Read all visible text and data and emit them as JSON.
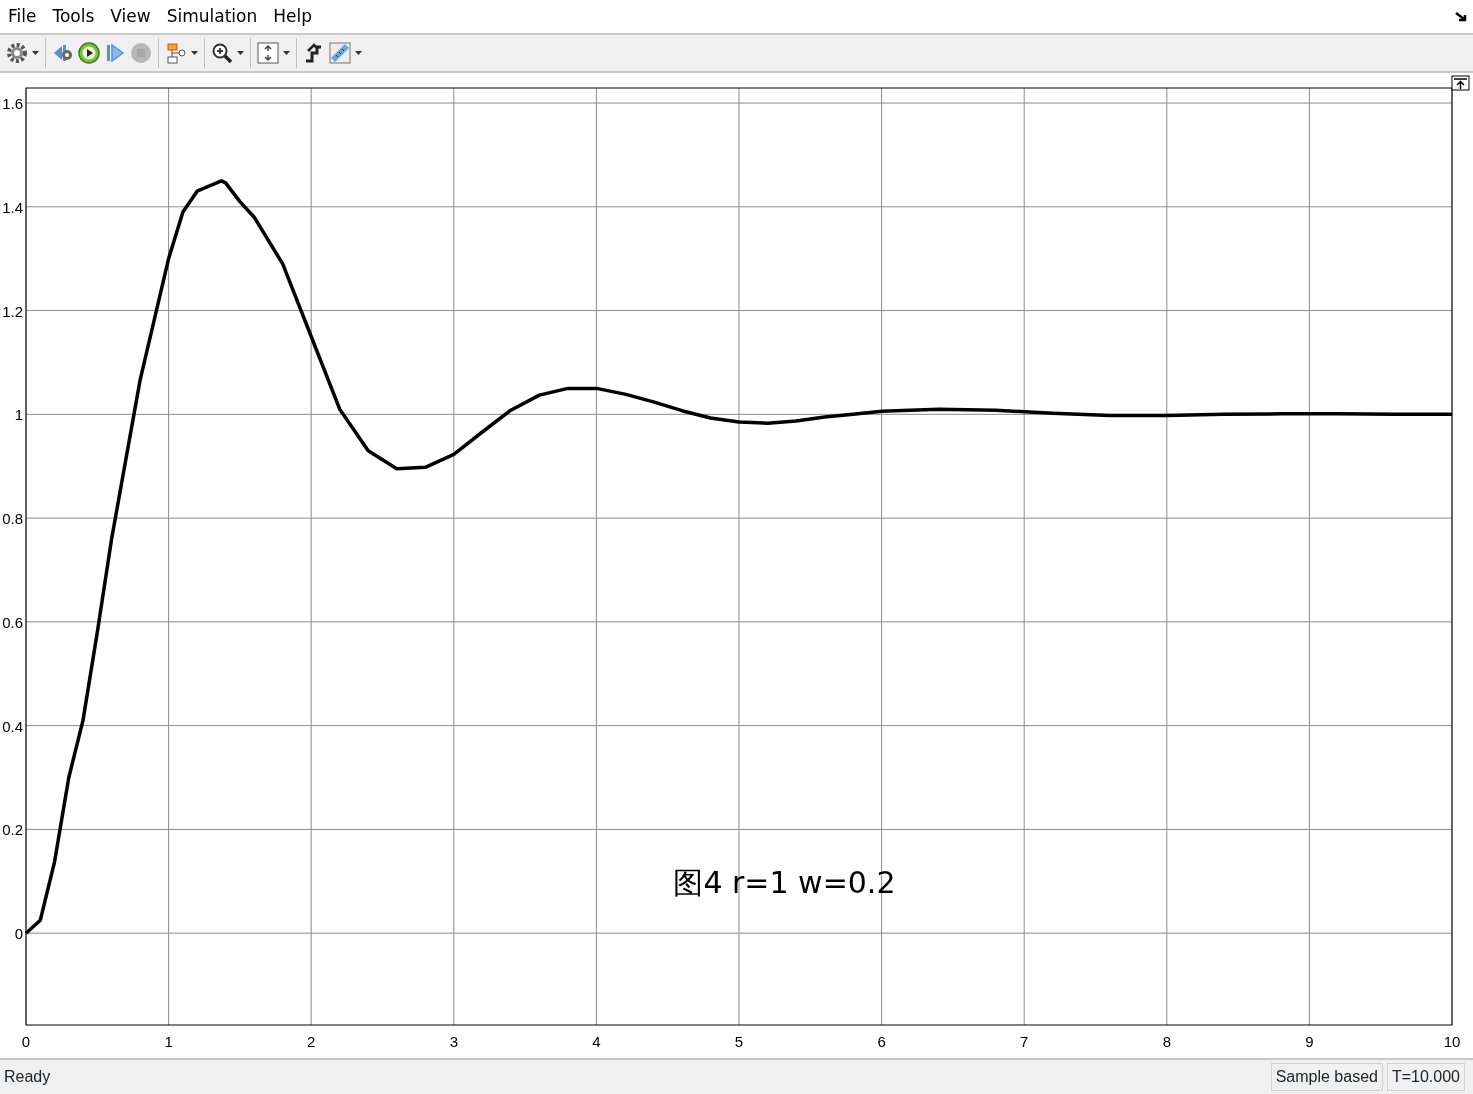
{
  "menu": [
    "File",
    "Tools",
    "View",
    "Simulation",
    "Help"
  ],
  "toolbar": [
    [
      {
        "kind": "settings",
        "dropdown": true,
        "disabled": false
      }
    ],
    [
      {
        "kind": "step-back",
        "dropdown": false,
        "disabled": false
      },
      {
        "kind": "run",
        "dropdown": false,
        "disabled": false
      },
      {
        "kind": "step-forward",
        "dropdown": false,
        "disabled": false
      },
      {
        "kind": "stop",
        "dropdown": false,
        "disabled": true
      }
    ],
    [
      {
        "kind": "signals",
        "dropdown": true,
        "disabled": false
      }
    ],
    [
      {
        "kind": "zoom",
        "dropdown": true,
        "disabled": false
      }
    ],
    [
      {
        "kind": "autoscale",
        "dropdown": true,
        "disabled": false
      }
    ],
    [
      {
        "kind": "highlight",
        "dropdown": false,
        "disabled": false
      },
      {
        "kind": "ruler",
        "dropdown": true,
        "disabled": false
      }
    ]
  ],
  "plot": {
    "chart_data": {
      "type": "line",
      "x": [
        0,
        0.1,
        0.2,
        0.3,
        0.4,
        0.5,
        0.6,
        0.8,
        1.0,
        1.1,
        1.2,
        1.37,
        1.4,
        1.5,
        1.6,
        1.8,
        2.0,
        2.2,
        2.4,
        2.6,
        2.8,
        3.0,
        3.2,
        3.4,
        3.6,
        3.8,
        4.0,
        4.2,
        4.4,
        4.6,
        4.8,
        5.0,
        5.2,
        5.4,
        5.6,
        5.8,
        6.0,
        6.4,
        6.8,
        7.2,
        7.6,
        8.0,
        8.4,
        8.8,
        9.2,
        9.6,
        10.0
      ],
      "series": [
        {
          "color": "#000000",
          "values": [
            0,
            0.025,
            0.137,
            0.3,
            0.41,
            0.58,
            0.76,
            1.066,
            1.3,
            1.39,
            1.43,
            1.45,
            1.446,
            1.41,
            1.38,
            1.29,
            1.15,
            1.01,
            0.93,
            0.895,
            0.898,
            0.923,
            0.966,
            1.008,
            1.037,
            1.05,
            1.05,
            1.039,
            1.024,
            1.007,
            0.993,
            0.985,
            0.983,
            0.987,
            0.995,
            1.0,
            1.006,
            1.01,
            1.008,
            1.002,
            0.998,
            0.998,
            1.0,
            1.001,
            1.001,
            1.0,
            1.0
          ]
        }
      ],
      "xlim": [
        0,
        10
      ],
      "ylim": [
        -0.177,
        1.629
      ],
      "xticks": [
        0,
        1,
        2,
        3,
        4,
        5,
        6,
        7,
        8,
        9,
        10
      ],
      "yticks": [
        0,
        0.2,
        0.4,
        0.6,
        0.8,
        1,
        1.2,
        1.4,
        1.6
      ],
      "grid": true,
      "annotations": [
        "图4 r=1 w=0.2"
      ]
    }
  },
  "status_bar": {
    "message": "Ready",
    "panels": [
      "Sample based",
      "T=10.000"
    ]
  }
}
